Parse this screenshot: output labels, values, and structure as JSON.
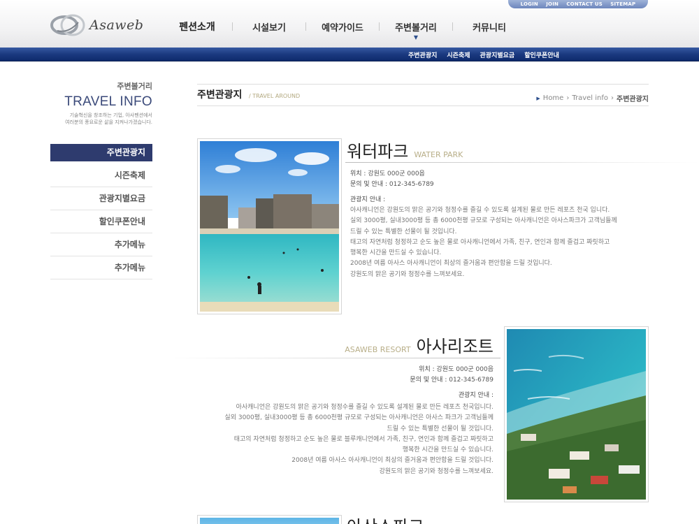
{
  "util_nav": [
    "LOGIN",
    "JOIN",
    "CONTACT US",
    "SITEMAP"
  ],
  "logo": {
    "text": "Asaweb"
  },
  "gnb": [
    "펜션소개",
    "시설보기",
    "예약가이드",
    "주변볼거리",
    "커뮤니티"
  ],
  "sub_nav": [
    "주변관광지",
    "시즌축제",
    "관광지별요금",
    "할인쿠폰안내"
  ],
  "lnb": {
    "kor": "주변볼거리",
    "title": "TRAVEL INFO",
    "desc": [
      "기술혁신을 창조하는 기업, 아사펜션에서",
      "여러분의 풍요로운 삶을 지켜나가겠습니다."
    ],
    "items": [
      "주변관광지",
      "시즌축제",
      "관광지별요금",
      "할인쿠폰안내",
      "추가메뉴",
      "추가메뉴"
    ]
  },
  "content": {
    "title": "주변관광지",
    "subtitle": "/ TRAVEL AROUND",
    "breadcrumb": [
      "Home",
      "Travel info",
      "주변관광지"
    ]
  },
  "sections": [
    {
      "kor": "워터파크",
      "eng": "WATER PARK",
      "location_label": "위치 :",
      "location": "강원도 000군 000읍",
      "contact_label": "문의 및 안내 :",
      "contact": "012-345-6789",
      "guide_label": "관광지 안내 :",
      "desc": [
        "아사캐니언은 강원도의 맑은 공기와 청정수를 즐길 수 있도록 설계된 물로 만든 레포츠 천국 입니다.",
        "실외 3000평, 실내3000평 등 총 6000천평 규모로 구성되는 아사캐니언은 아사스파크가 고객님들께",
        "드릴 수 있는 특별한 선물이 될 것입니다.",
        "태고의 자연처럼 청정하고 순도 높은 물로 아사캐니언에서 가족, 친구, 연인과 함께 즐겁고 짜릿하고",
        "행복한 시간을 만드실 수 있습니다.",
        "2008년 여름 아사스 아사캐니언이 최상의 즐거움과 편안함을 드릴 것입니다.",
        "강원도의 맑은 공기와 청정수를 느껴보세요."
      ]
    },
    {
      "kor": "아사리조트",
      "eng": "ASAWEB RESORT",
      "location_label": "위치 :",
      "location": "강원도 000군 000읍",
      "contact_label": "문의 및 안내 :",
      "contact": "012-345-6789",
      "guide_label": "관광지 안내 :",
      "desc": [
        "아사캐니언은 강원도의 맑은 공기와 청정수를 즐길 수 있도록 설계된 물로 만든 레포츠 천국입니다.",
        "실외 3000평, 실내3000평 등 총 6000천평 규모로 구성되는 아사캐니언은 아사스 파크가 고객님들께",
        "드릴 수 있는 특별한 선물이 될 것입니다.",
        "태고의 자연처럼 청정하고 순도 높은 물로 블루캐니언에서 가족, 친구, 연인과 함께 즐겁고 짜릿하고",
        "행복한 시간을 만드실 수 있습니다.",
        "2008년 여름 아사스 아사캐니언이 최상의 즐거움과 편안함을 드릴 것입니다.",
        "강원도의 맑은 공기와 청정수를 느껴보세요."
      ]
    },
    {
      "kor": "아산스파크"
    }
  ],
  "colors": {
    "nav_blue": "#1b3a80",
    "lnb_active": "#2e3b6e",
    "accent_tan": "#b8ae88"
  }
}
